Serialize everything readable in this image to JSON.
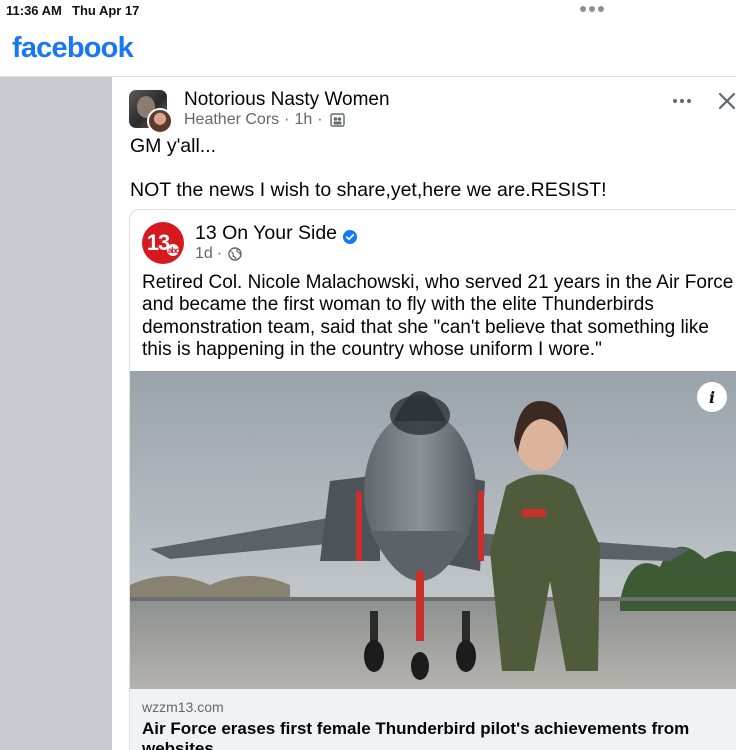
{
  "status_bar": {
    "time": "11:36 AM",
    "date": "Thu Apr 17"
  },
  "header": {
    "logo_text": "facebook",
    "brand_color": "#1877f2"
  },
  "post": {
    "group_name": "Notorious Nasty Women",
    "author": "Heather Cors",
    "time": "1h",
    "audience_icon": "members-icon",
    "text_lines": [
      "GM y'all...",
      "NOT the news I wish to share,yet,here we are.RESIST!"
    ],
    "shared": {
      "logo_text": "13",
      "logo_badge": "abc",
      "page_name": "13 On Your Side",
      "verified_icon": "verified-badge-icon",
      "time": "1d",
      "audience_icon": "globe-icon",
      "text": "Retired Col. Nicole Malachowski, who served 21 years in the Air Force and became the first woman to fly with the elite Thunderbirds demonstration team, said that she \"can't believe that something like this is happening in the country whose uniform I wore.\"",
      "info_label": "i",
      "link": {
        "domain": "wzzm13.com",
        "title": "Air Force erases first female Thunderbird pilot's achievements from websites"
      }
    }
  }
}
